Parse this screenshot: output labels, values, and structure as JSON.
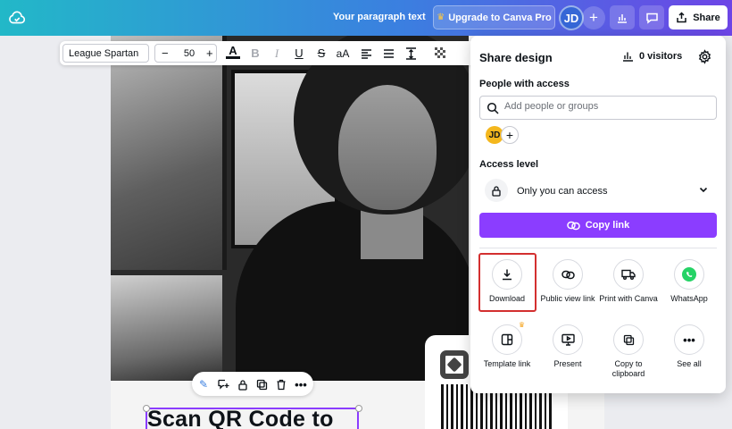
{
  "topbar": {
    "doc_title": "Your paragraph text",
    "upgrade_label": "Upgrade to Canva Pro",
    "avatar_initials": "JD",
    "share_label": "Share"
  },
  "text_toolbar": {
    "font_name": "League Spartan",
    "font_size": "50",
    "minus": "−",
    "plus": "+",
    "case_label": "aA"
  },
  "canvas": {
    "headline": "Scan QR Code to"
  },
  "share_panel": {
    "title": "Share design",
    "visitors": "0 visitors",
    "people_label": "People with access",
    "search_placeholder": "Add people or groups",
    "member_initials": "JD",
    "access_label": "Access level",
    "access_value": "Only you can access",
    "copy_link_label": "Copy link",
    "options": [
      {
        "label": "Download"
      },
      {
        "label": "Public view link"
      },
      {
        "label": "Print with Canva"
      },
      {
        "label": "WhatsApp"
      },
      {
        "label": "Template link"
      },
      {
        "label": "Present"
      },
      {
        "label": "Copy to clipboard"
      },
      {
        "label": "See all"
      }
    ]
  },
  "colors": {
    "accent": "#8b3dff",
    "highlight": "#d32f2f",
    "whatsapp": "#25d366"
  }
}
